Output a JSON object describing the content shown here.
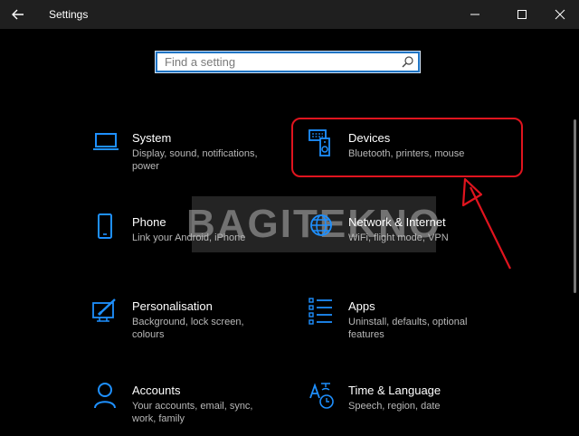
{
  "window": {
    "title": "Settings",
    "back_icon": "back-arrow-icon",
    "controls": [
      "minimize-icon",
      "maximize-icon",
      "close-icon"
    ]
  },
  "search": {
    "placeholder": "Find a setting",
    "icon": "search-icon"
  },
  "watermark": "BAGITEKNO",
  "colors": {
    "accent": "#1f74c4",
    "icon_blue": "#1e90ff",
    "highlight_red": "#e0141e",
    "desc_gray": "#b8b8b8"
  },
  "categories": [
    {
      "name": "System",
      "desc": "Display, sound, notifications, power",
      "icon": "laptop-icon"
    },
    {
      "name": "Devices",
      "desc": "Bluetooth, printers, mouse",
      "icon": "keyboard-speaker-icon"
    },
    {
      "name": "Phone",
      "desc": "Link your Android, iPhone",
      "icon": "phone-icon"
    },
    {
      "name": "Network & Internet",
      "desc": "WiFi, flight mode, VPN",
      "icon": "globe-icon"
    },
    {
      "name": "Personalisation",
      "desc": "Background, lock screen, colours",
      "icon": "paint-icon"
    },
    {
      "name": "Apps",
      "desc": "Uninstall, defaults, optional features",
      "icon": "apps-list-icon"
    },
    {
      "name": "Accounts",
      "desc": "Your accounts, email, sync, work, family",
      "icon": "person-icon"
    },
    {
      "name": "Time & Language",
      "desc": "Speech, region, date",
      "icon": "time-language-icon"
    }
  ]
}
